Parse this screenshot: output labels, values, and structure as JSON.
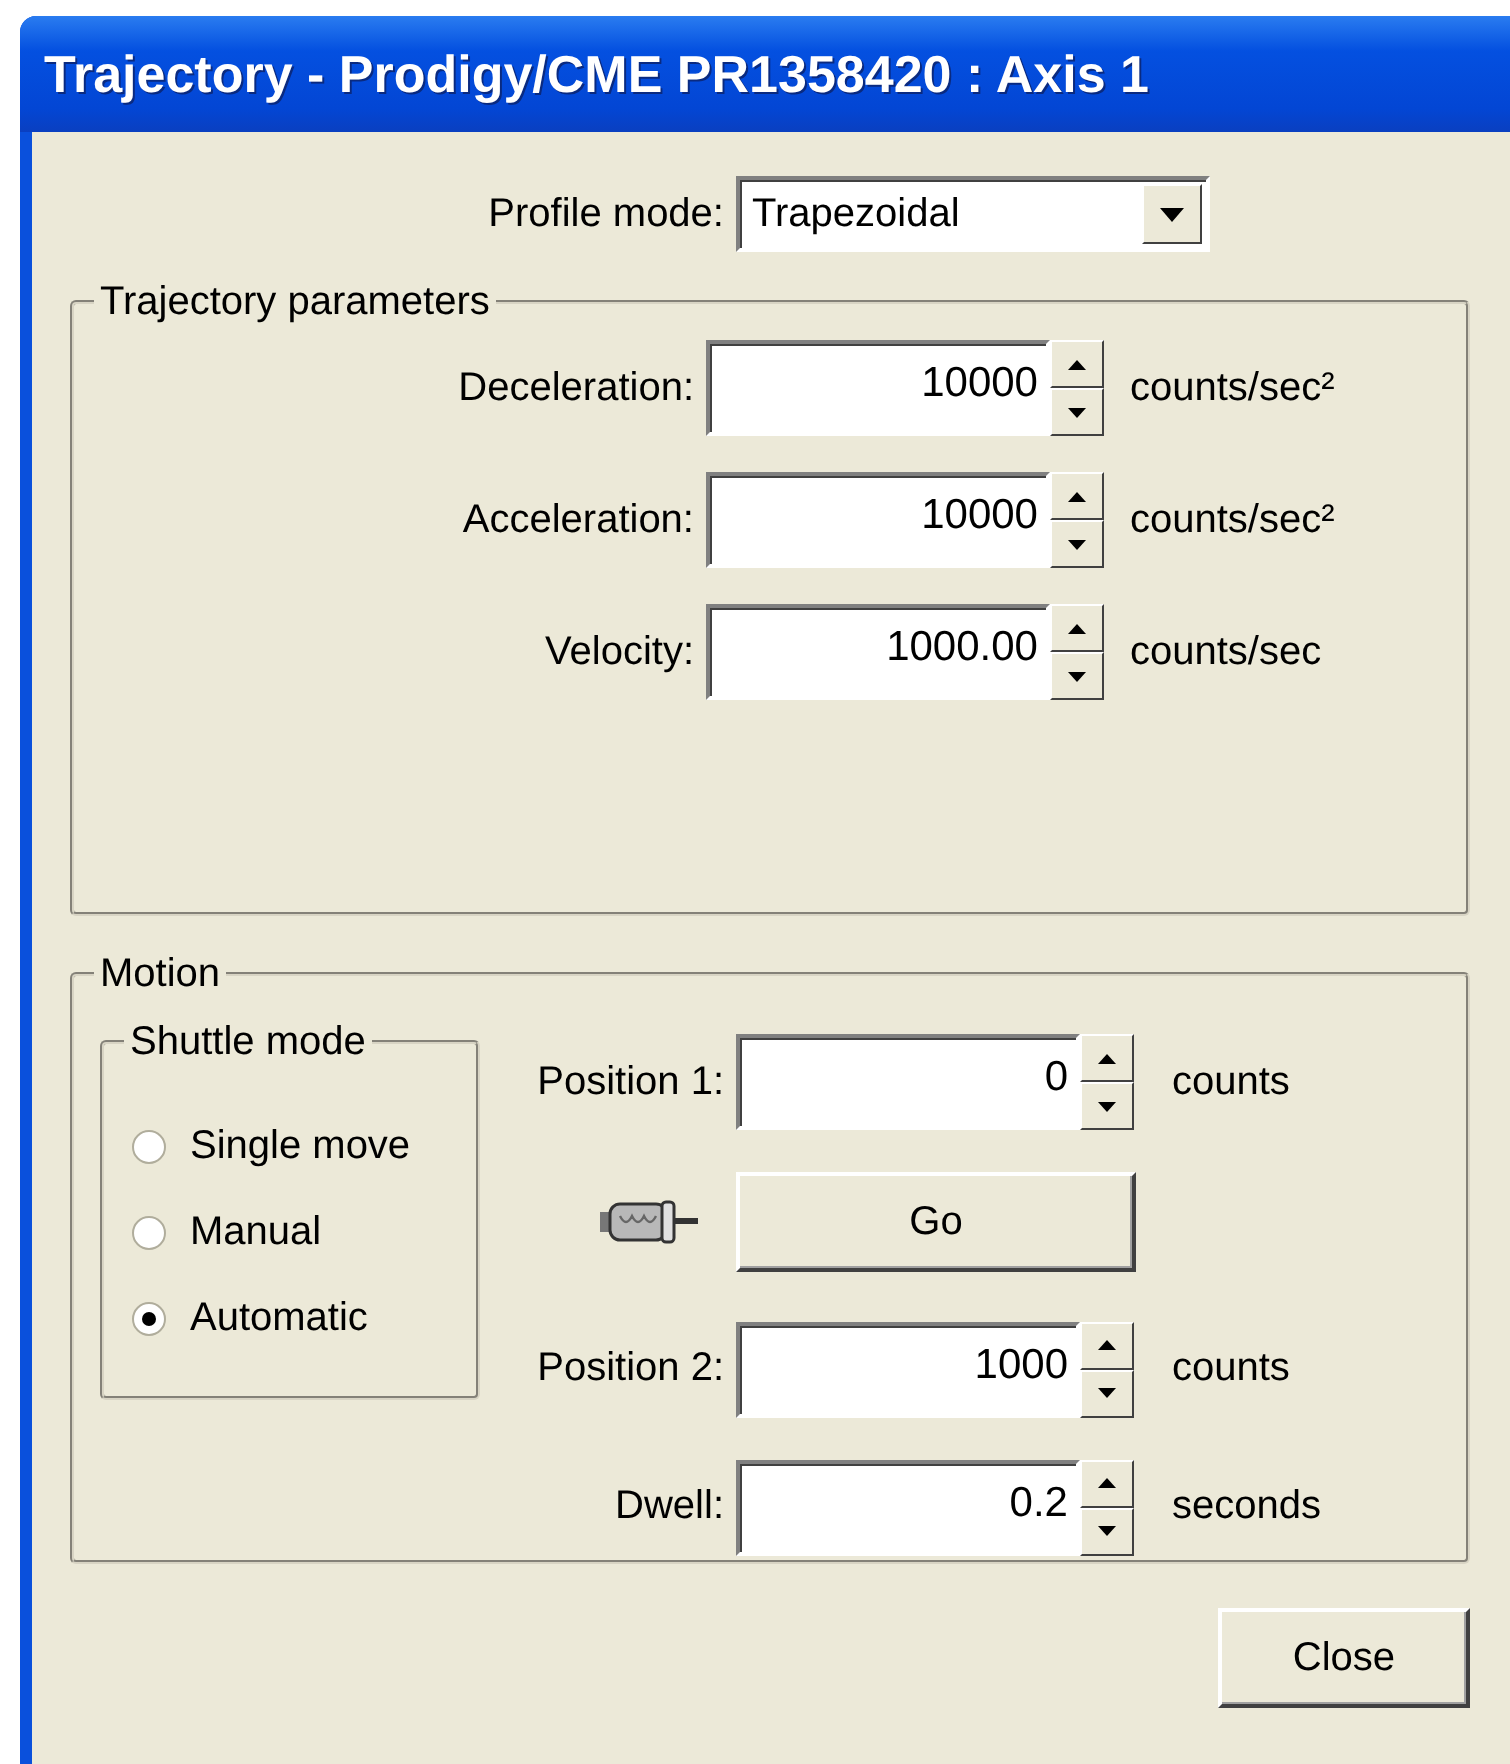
{
  "window": {
    "title": "Trajectory - Prodigy/CME PR1358420 :  Axis 1"
  },
  "profile_mode": {
    "label": "Profile mode:",
    "value": "Trapezoidal"
  },
  "trajectory_parameters": {
    "title": "Trajectory parameters",
    "fields": [
      {
        "label": "Deceleration:",
        "value": "10000",
        "unit": "counts/sec²"
      },
      {
        "label": "Acceleration:",
        "value": "10000",
        "unit": "counts/sec²"
      },
      {
        "label": "Velocity:",
        "value": "1000.00",
        "unit": "counts/sec"
      }
    ]
  },
  "motion": {
    "title": "Motion",
    "shuttle_mode": {
      "title": "Shuttle mode",
      "options": [
        {
          "label": "Single move",
          "selected": false
        },
        {
          "label": "Manual",
          "selected": false
        },
        {
          "label": "Automatic",
          "selected": true
        }
      ]
    },
    "rows": [
      {
        "kind": "field",
        "label": "Position 1:",
        "value": "0",
        "unit": "counts"
      },
      {
        "kind": "button",
        "label": "Go"
      },
      {
        "kind": "field",
        "label": "Position 2:",
        "value": "1000",
        "unit": "counts"
      },
      {
        "kind": "field",
        "label": "Dwell:",
        "value": "0.2",
        "unit": "seconds"
      }
    ]
  },
  "buttons": [
    {
      "label": "Close"
    }
  ]
}
